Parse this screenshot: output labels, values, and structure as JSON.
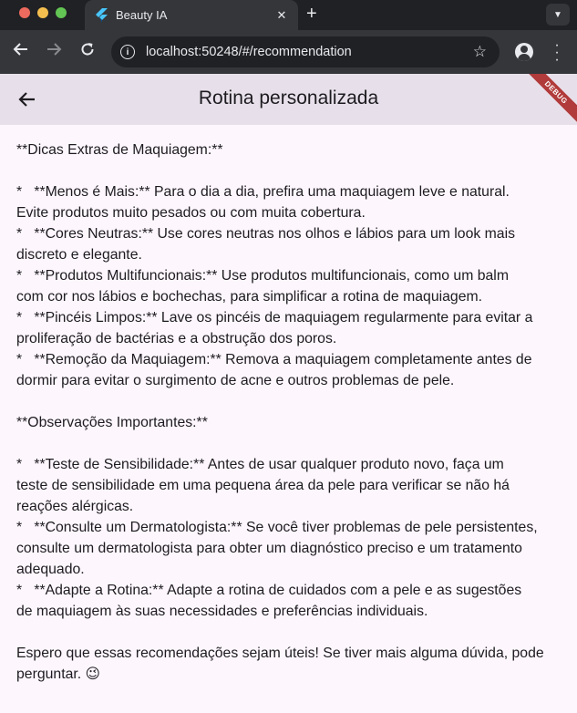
{
  "browser": {
    "tab_title": "Beauty IA",
    "url": "localhost:50248/#/recommendation",
    "new_tab_label": "+"
  },
  "appbar": {
    "title": "Rotina personalizada",
    "debug_label": "DEBUG"
  },
  "content": {
    "lines": [
      "**Dicas Extras de Maquiagem:**",
      "",
      "*   **Menos é Mais:** Para o dia a dia, prefira uma maquiagem leve e natural.",
      "Evite produtos muito pesados ou com muita cobertura.",
      "*   **Cores Neutras:** Use cores neutras nos olhos e lábios para um look mais",
      "discreto e elegante.",
      "*   **Produtos Multifuncionais:** Use produtos multifuncionais, como um balm",
      "com cor nos lábios e bochechas, para simplificar a rotina de maquiagem.",
      "*   **Pincéis Limpos:** Lave os pincéis de maquiagem regularmente para evitar a",
      "proliferação de bactérias e a obstrução dos poros.",
      "*   **Remoção da Maquiagem:** Remova a maquiagem completamente antes de",
      "dormir para evitar o surgimento de acne e outros problemas de pele.",
      "",
      "**Observações Importantes:**",
      "",
      "*   **Teste de Sensibilidade:** Antes de usar qualquer produto novo, faça um",
      "teste de sensibilidade em uma pequena área da pele para verificar se não há",
      "reações alérgicas.",
      "*   **Consulte um Dermatologista:** Se você tiver problemas de pele persistentes,",
      "consulte um dermatologista para obter um diagnóstico preciso e um tratamento",
      "adequado.",
      "*   **Adapte a Rotina:** Adapte a rotina de cuidados com a pele e as sugestões",
      "de maquiagem às suas necessidades e preferências individuais.",
      "",
      "Espero que essas recomendações sejam úteis! Se tiver mais alguma dúvida, pode",
      "perguntar. 😉"
    ]
  }
}
